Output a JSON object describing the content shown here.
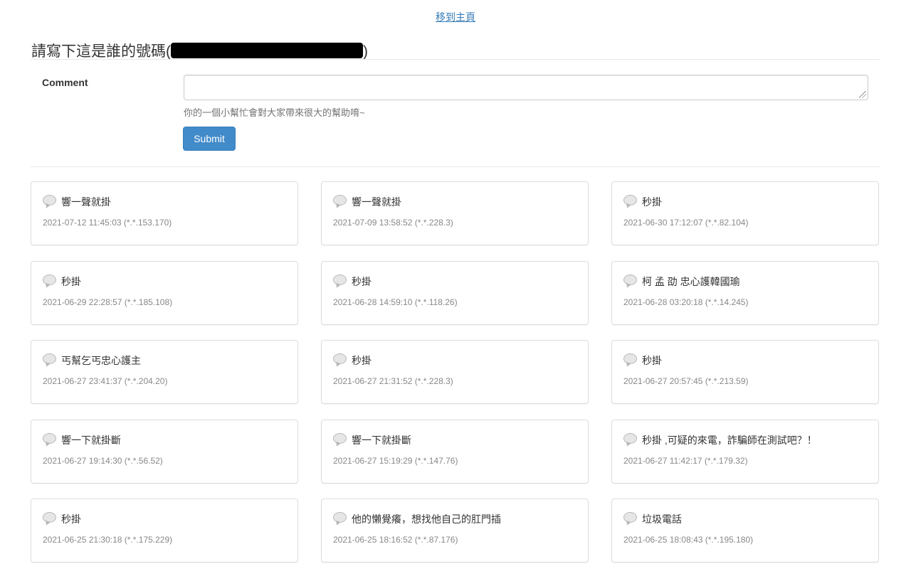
{
  "nav": {
    "home_link": "移到主頁"
  },
  "page": {
    "heading_prefix": "請寫下這是誰的號碼(",
    "heading_suffix": ")"
  },
  "form": {
    "label": "Comment",
    "value": "",
    "help": "你的一個小幫忙會對大家帶來很大的幫助唷~",
    "submit": "Submit"
  },
  "comments": [
    {
      "text": "響一聲就掛",
      "meta": "2021-07-12 11:45:03 (*.*.153.170)"
    },
    {
      "text": "響一聲就掛",
      "meta": "2021-07-09 13:58:52 (*.*.228.3)"
    },
    {
      "text": "秒掛",
      "meta": "2021-06-30 17:12:07 (*.*.82.104)"
    },
    {
      "text": "秒掛",
      "meta": "2021-06-29 22:28:57 (*.*.185.108)"
    },
    {
      "text": "秒掛",
      "meta": "2021-06-28 14:59:10 (*.*.118.26)"
    },
    {
      "text": "柯 孟 劭 忠心護韓國瑜",
      "meta": "2021-06-28 03:20:18 (*.*.14.245)"
    },
    {
      "text": "丐幫乞丐忠心護主",
      "meta": "2021-06-27 23:41:37 (*.*.204.20)"
    },
    {
      "text": "秒掛",
      "meta": "2021-06-27 21:31:52 (*.*.228.3)"
    },
    {
      "text": "秒掛",
      "meta": "2021-06-27 20:57:45 (*.*.213.59)"
    },
    {
      "text": "響一下就掛斷",
      "meta": "2021-06-27 19:14:30 (*.*.56.52)"
    },
    {
      "text": "響一下就掛斷",
      "meta": "2021-06-27 15:19:29 (*.*.147.76)"
    },
    {
      "text": "秒掛 ,可疑的來電，詐騙師在測試吧？！",
      "meta": "2021-06-27 11:42:17 (*.*.179.32)"
    },
    {
      "text": "秒掛",
      "meta": "2021-06-25 21:30:18 (*.*.175.229)"
    },
    {
      "text": "他的懶覺癢，想找他自己的肛門插",
      "meta": "2021-06-25 18:16:52 (*.*.87.176)"
    },
    {
      "text": "垃圾電話",
      "meta": "2021-06-25 18:08:43 (*.*.195.180)"
    }
  ]
}
